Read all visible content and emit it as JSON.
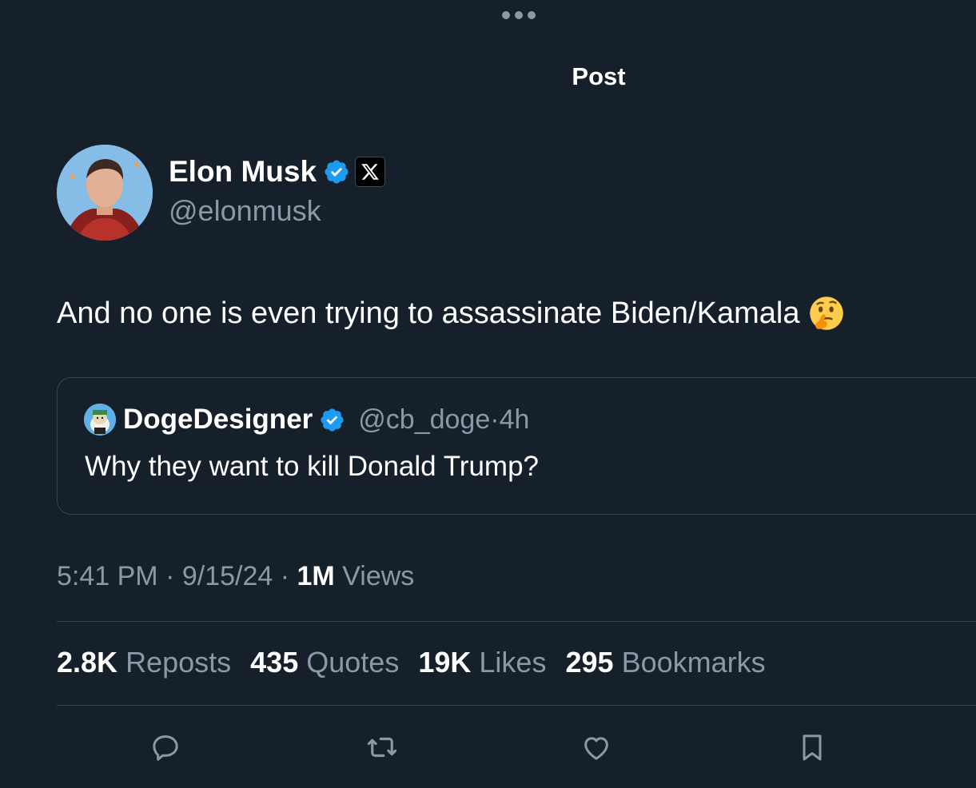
{
  "header": {
    "title": "Post"
  },
  "author": {
    "name": "Elon Musk",
    "handle": "@elonmusk"
  },
  "tweet": {
    "text": "And no one is even trying to assassinate Biden/Kamala",
    "emoji": "thinking-face"
  },
  "quoted": {
    "name": "DogeDesigner",
    "handle": "@cb_doge",
    "sep": "·",
    "age": "4h",
    "text": "Why they want to kill Donald Trump?"
  },
  "meta": {
    "time": "5:41 PM",
    "date": "9/15/24",
    "views_count": "1M",
    "views_label": "Views"
  },
  "stats": [
    {
      "count": "2.8K",
      "label": "Reposts"
    },
    {
      "count": "435",
      "label": "Quotes"
    },
    {
      "count": "19K",
      "label": "Likes"
    },
    {
      "count": "295",
      "label": "Bookmarks"
    }
  ],
  "actions": [
    "reply-icon",
    "repost-icon",
    "like-icon",
    "bookmark-icon"
  ],
  "colors": {
    "background": "#15202b",
    "verified": "#1d9bf0",
    "secondary_text": "#8b98a5",
    "divider": "#38444d"
  }
}
